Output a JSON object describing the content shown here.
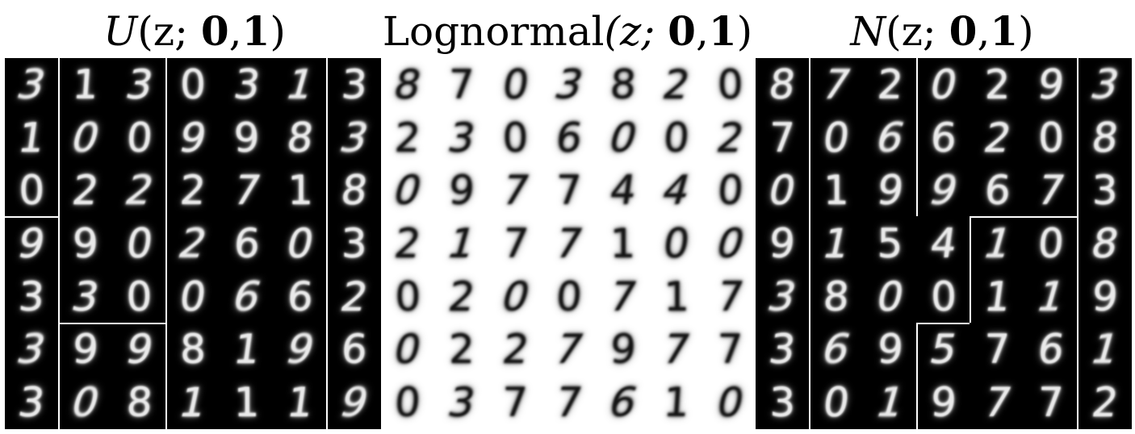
{
  "panels": [
    {
      "id": "uniform",
      "title": {
        "dist": "U",
        "args": "(z;",
        "zero": "0",
        "comma": ",",
        "one": "1",
        "close": ")"
      },
      "theme": "dark",
      "grid": [
        [
          "3",
          "1",
          "3",
          "0",
          "3",
          "1",
          "3"
        ],
        [
          "1",
          "0",
          "0",
          "9",
          "9",
          "8",
          "3"
        ],
        [
          "0",
          "2",
          "2",
          "2",
          "7",
          "1",
          "8"
        ],
        [
          "9",
          "9",
          "0",
          "2",
          "6",
          "0",
          "3"
        ],
        [
          "3",
          "3",
          "0",
          "0",
          "6",
          "6",
          "2"
        ],
        [
          "3",
          "9",
          "9",
          "8",
          "1",
          "9",
          "6"
        ],
        [
          "3",
          "0",
          "8",
          "1",
          "1",
          "1",
          "9"
        ]
      ]
    },
    {
      "id": "lognormal",
      "title": {
        "dist": "Lognormal",
        "args": "(z;",
        "zero": "0",
        "comma": ",",
        "one": "1",
        "close": ")"
      },
      "theme": "light",
      "grid": [
        [
          "8",
          "7",
          "0",
          "3",
          "8",
          "2",
          "0"
        ],
        [
          "2",
          "3",
          "0",
          "6",
          "0",
          "0",
          "2"
        ],
        [
          "0",
          "9",
          "7",
          "7",
          "4",
          "4",
          "0"
        ],
        [
          "2",
          "1",
          "7",
          "7",
          "1",
          "0",
          "0"
        ],
        [
          "0",
          "2",
          "0",
          "0",
          "7",
          "1",
          "7"
        ],
        [
          "0",
          "2",
          "2",
          "7",
          "9",
          "7",
          "7"
        ],
        [
          "0",
          "3",
          "7",
          "7",
          "6",
          "1",
          "0"
        ]
      ]
    },
    {
      "id": "normal",
      "title": {
        "dist": "N",
        "args": "(z;",
        "zero": "0",
        "comma": ",",
        "one": "1",
        "close": ")"
      },
      "theme": "dark",
      "grid": [
        [
          "8",
          "7",
          "2",
          "0",
          "2",
          "9",
          "3"
        ],
        [
          "7",
          "0",
          "6",
          "6",
          "2",
          "0",
          "8"
        ],
        [
          "0",
          "1",
          "9",
          "9",
          "6",
          "7",
          "3"
        ],
        [
          "9",
          "1",
          "5",
          "4",
          "1",
          "0",
          "8"
        ],
        [
          "3",
          "8",
          "0",
          "0",
          "1",
          "1",
          "9"
        ],
        [
          "3",
          "6",
          "9",
          "5",
          "7",
          "6",
          "1"
        ],
        [
          "3",
          "0",
          "1",
          "9",
          "7",
          "7",
          "2"
        ]
      ]
    }
  ]
}
